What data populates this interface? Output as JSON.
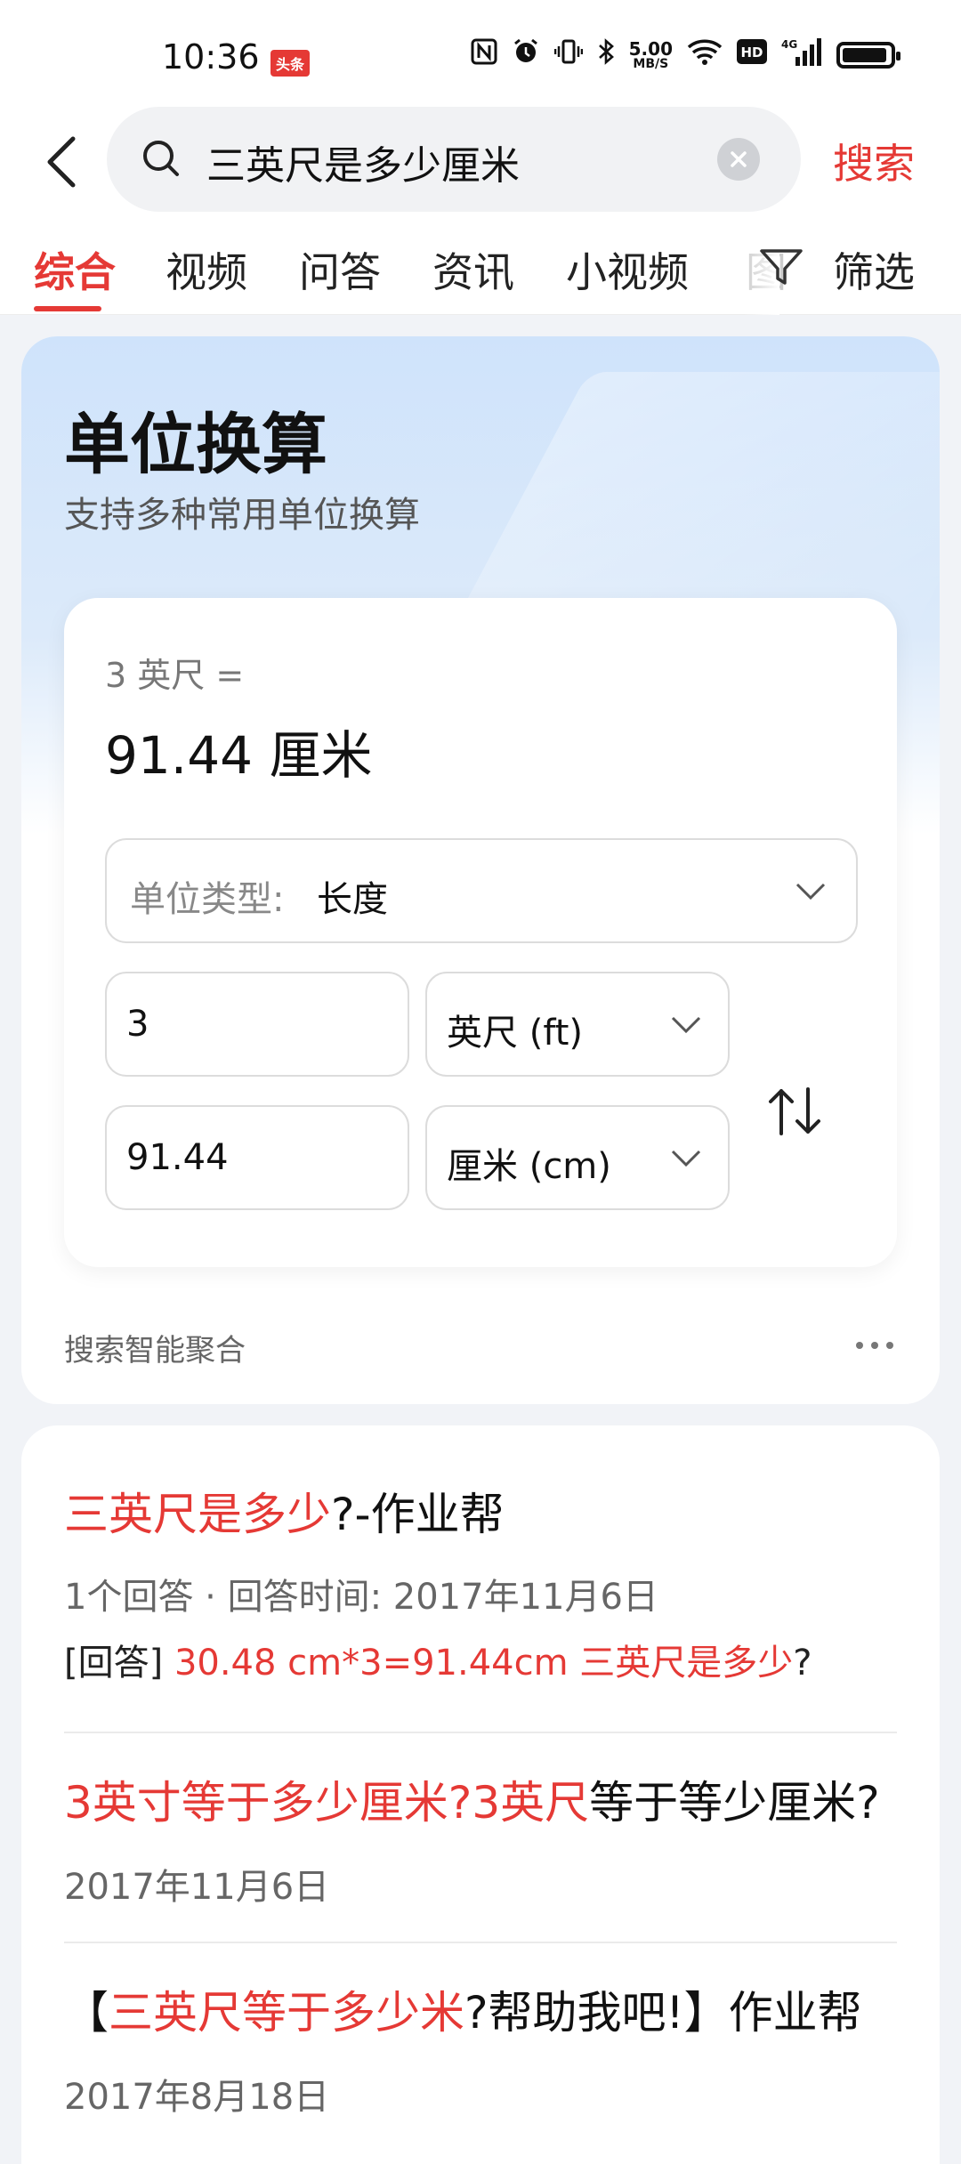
{
  "status_bar": {
    "time": "10:36",
    "app_badge": "头条",
    "net_speed_top": "5.00",
    "net_speed_bottom": "MB/S",
    "hd": "HD",
    "signal_label": "4G"
  },
  "search": {
    "query": "三英尺是多少厘米",
    "submit_label": "搜索"
  },
  "tabs": [
    {
      "label": "综合",
      "active": true
    },
    {
      "label": "视频"
    },
    {
      "label": "问答"
    },
    {
      "label": "资讯"
    },
    {
      "label": "小视频"
    },
    {
      "label": "筛选"
    }
  ],
  "unit_card": {
    "title": "单位换算",
    "subtitle": "支持多种常用单位换算",
    "expression": "3 英尺 =",
    "result": "91.44  厘米",
    "type_label": "单位类型:",
    "type_value": "长度",
    "from_value": "3",
    "from_unit": "英尺 (ft)",
    "to_value": "91.44",
    "to_unit": "厘米 (cm)",
    "aggregation_label": "搜索智能聚合"
  },
  "results": [
    {
      "title_hl": "三英尺是多少",
      "title_rest": "?-作业帮",
      "meta": "1个回答 · 回答时间: 2017年11月6日",
      "snippet_prefix": "[回答] ",
      "snippet_hl": "30.48 cm*3=91.44cm 三英尺是多少",
      "snippet_suffix": "?"
    },
    {
      "title_hl": "3英寸等于多少厘米?3英尺",
      "title_rest": "等于等少厘米?",
      "meta": "2017年11月6日"
    },
    {
      "title_prefix": "【",
      "title_hl": "三英尺等于多少米",
      "title_rest": "?帮助我吧!】作业帮",
      "meta": "2017年8月18日"
    }
  ],
  "colors": {
    "accent": "#e53935",
    "card_gradient_top": "#cfe3fb"
  }
}
